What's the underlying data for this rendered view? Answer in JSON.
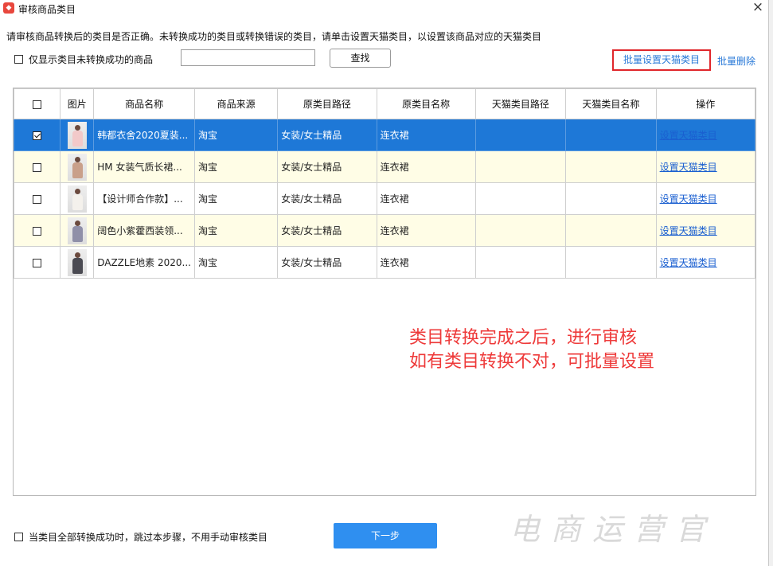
{
  "window": {
    "title": "审核商品类目",
    "close_glyph": "×"
  },
  "instruction": "请审核商品转换后的类目是否正确。未转换成功的类目或转换错误的类目，请单击设置天猫类目，以设置该商品对应的天猫类目",
  "filter": {
    "checkbox_label": "仅显示类目未转换成功的商品",
    "checked": false,
    "search_value": "",
    "find_button": "查找"
  },
  "actions": {
    "batch_set": "批量设置天猫类目",
    "batch_delete": "批量删除"
  },
  "table": {
    "headers": [
      "图片",
      "商品名称",
      "商品来源",
      "原类目路径",
      "原类目名称",
      "天猫类目路径",
      "天猫类目名称",
      "操作"
    ],
    "rows": [
      {
        "checked": true,
        "name": "韩都衣舍2020夏装...",
        "source": "淘宝",
        "orig_path": "女装/女士精品",
        "orig_name": "连衣裙",
        "tmall_path": "",
        "tmall_name": "",
        "action": "设置天猫类目",
        "thumb_color": "#f2c9c9"
      },
      {
        "checked": false,
        "name": "HM 女装气质长裙...",
        "source": "淘宝",
        "orig_path": "女装/女士精品",
        "orig_name": "连衣裙",
        "tmall_path": "",
        "tmall_name": "",
        "action": "设置天猫类目",
        "thumb_color": "#c9a08a"
      },
      {
        "checked": false,
        "name": "【设计师合作款】...",
        "source": "淘宝",
        "orig_path": "女装/女士精品",
        "orig_name": "连衣裙",
        "tmall_path": "",
        "tmall_name": "",
        "action": "设置天猫类目",
        "thumb_color": "#f4f1ec"
      },
      {
        "checked": false,
        "name": "阔色小紫藿西装领...",
        "source": "淘宝",
        "orig_path": "女装/女士精品",
        "orig_name": "连衣裙",
        "tmall_path": "",
        "tmall_name": "",
        "action": "设置天猫类目",
        "thumb_color": "#8f8fa8"
      },
      {
        "checked": false,
        "name": "DAZZLE地素 2020...",
        "source": "淘宝",
        "orig_path": "女装/女士精品",
        "orig_name": "连衣裙",
        "tmall_path": "",
        "tmall_name": "",
        "action": "设置天猫类目",
        "thumb_color": "#4a4a52"
      }
    ]
  },
  "annotation": {
    "line1": "类目转换完成之后，进行审核",
    "line2": "如有类目转换不对，可批量设置"
  },
  "footer": {
    "skip_label": "当类目全部转换成功时，跳过本步骤，不用手动审核类目",
    "skip_checked": false,
    "next_button": "下一步"
  },
  "watermark": "电商运营官",
  "colors": {
    "selected_row": "#1e78d7",
    "alt_row": "#fffde6",
    "link": "#1a5fd0",
    "highlight_box": "#e0262b",
    "annotation": "#ee3a3a",
    "primary_button": "#2f8ff0"
  }
}
